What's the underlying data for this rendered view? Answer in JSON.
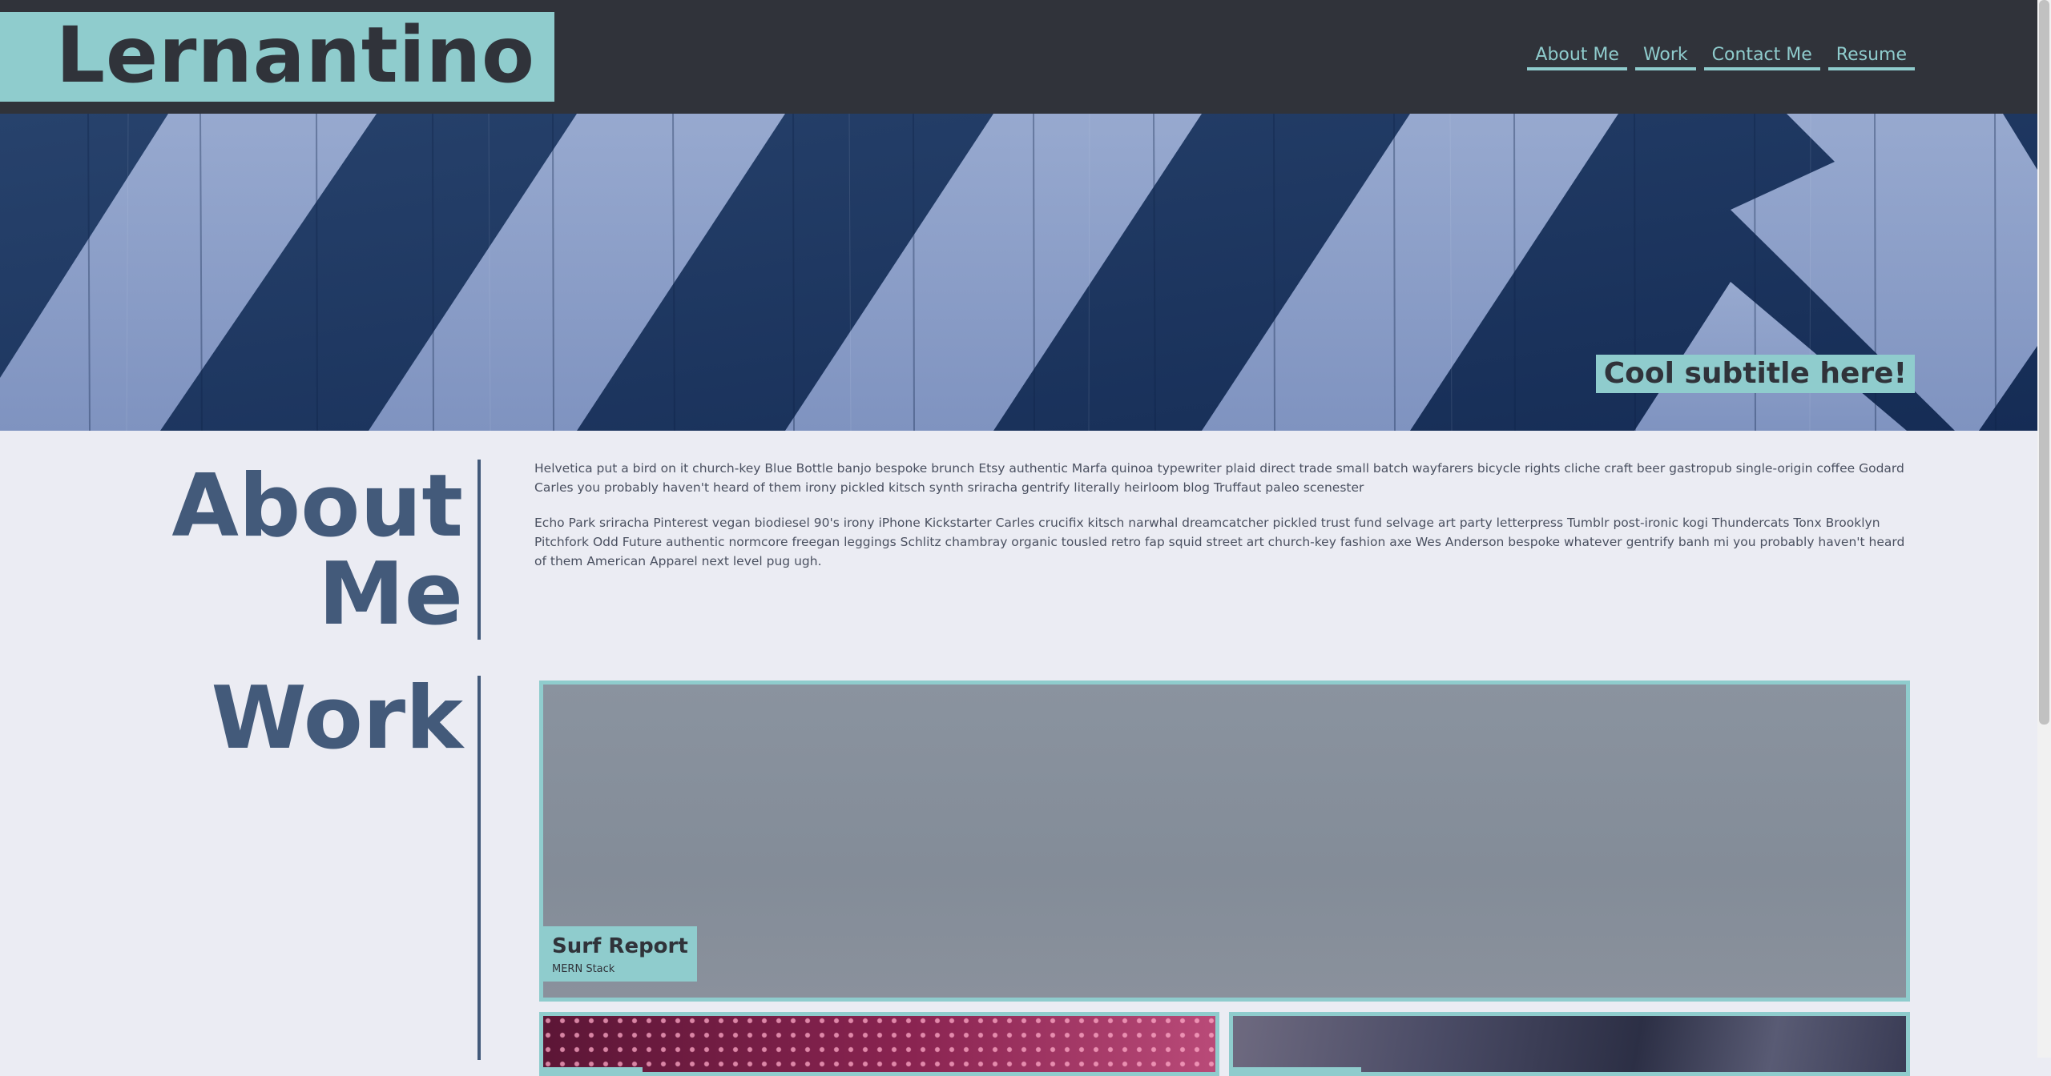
{
  "brand": {
    "name": "Lernantino"
  },
  "nav": {
    "items": [
      {
        "label": "About Me"
      },
      {
        "label": "Work"
      },
      {
        "label": "Contact Me"
      },
      {
        "label": "Resume"
      }
    ]
  },
  "hero": {
    "subtitle": "Cool subtitle here!"
  },
  "about": {
    "title_line1": "About",
    "title_line2": "Me",
    "paragraphs": [
      "Helvetica put a bird on it church-key Blue Bottle banjo bespoke brunch Etsy authentic Marfa quinoa typewriter plaid direct trade small batch wayfarers bicycle rights cliche craft beer gastropub single-origin coffee Godard Carles you probably haven't heard of them irony pickled kitsch synth sriracha gentrify literally heirloom blog Truffaut paleo scenester",
      "Echo Park sriracha Pinterest vegan biodiesel 90's irony iPhone Kickstarter Carles crucifix kitsch narwhal dreamcatcher pickled trust fund selvage art party letterpress Tumblr post-ironic kogi Thundercats Tonx Brooklyn Pitchfork Odd Future authentic normcore freegan leggings Schlitz chambray organic tousled retro fap squid street art church-key fashion axe Wes Anderson bespoke whatever gentrify banh mi you probably haven't heard of them American Apparel next level pug ugh."
    ]
  },
  "work": {
    "title": "Work",
    "projects": [
      {
        "title": "Surf Report",
        "subtitle": "MERN Stack"
      }
    ]
  },
  "colors": {
    "header_bg": "#30333a",
    "accent": "#8fcccd",
    "heading": "#435a7a",
    "page_bg": "#ebecf3"
  }
}
